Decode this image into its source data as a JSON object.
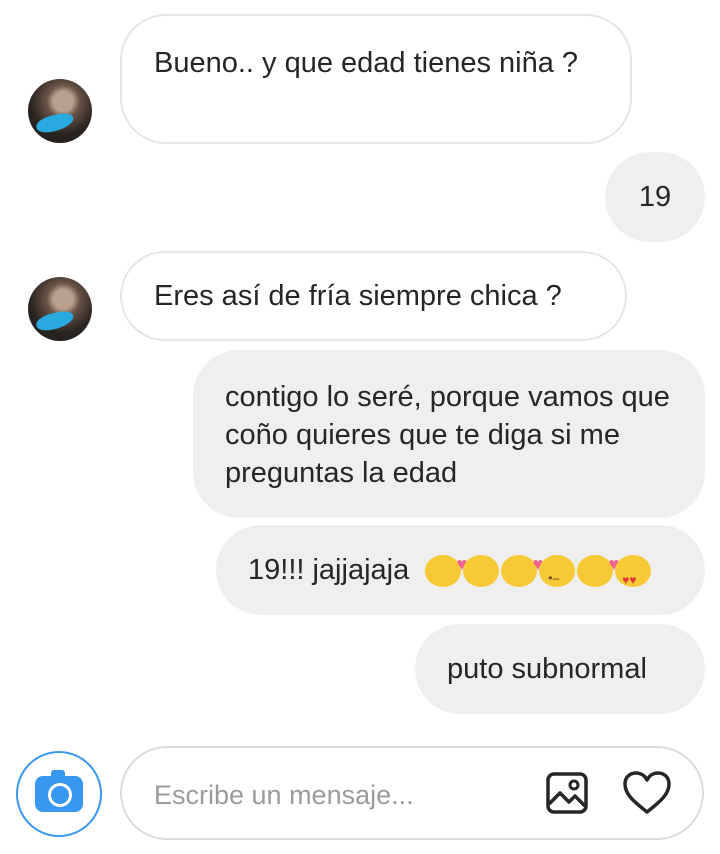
{
  "messages": [
    {
      "from": "them",
      "text": "Bueno.. y que edad tienes niña ?"
    },
    {
      "from": "me",
      "text": "19"
    },
    {
      "from": "them",
      "text": "Eres así de fría siempre chica ?"
    },
    {
      "from": "me",
      "text": "contigo lo seré, porque vamos que coño quieres que te diga si me preguntas la edad"
    },
    {
      "from": "me",
      "text": "19!!! jajjajaja",
      "emojis": [
        "kissing-heart",
        "grin",
        "kissing-heart",
        "wink",
        "kissing-heart",
        "heart-eyes"
      ]
    },
    {
      "from": "me",
      "text": "puto subnormal"
    }
  ],
  "composer": {
    "placeholder": "Escribe un mensaje...",
    "accent": "#3897f0"
  },
  "icons": {
    "camera": "camera-icon",
    "gallery": "image-icon",
    "like": "heart-icon"
  }
}
